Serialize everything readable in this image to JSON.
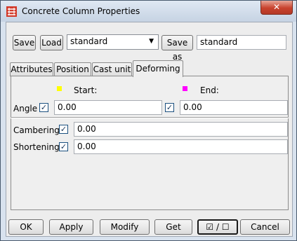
{
  "window": {
    "title": "Concrete Column Properties",
    "close_label": "✕"
  },
  "toolbar": {
    "save_label": "Save",
    "load_label": "Load",
    "preset_value": "standard",
    "save_as_label": "Save as",
    "save_as_value": "standard"
  },
  "tabs": [
    {
      "label": "Attributes"
    },
    {
      "label": "Position"
    },
    {
      "label": "Cast unit"
    },
    {
      "label": "Deforming",
      "active": true
    }
  ],
  "deforming": {
    "start_label": "Start:",
    "end_label": "End:",
    "start_color": "#ffff00",
    "end_color": "#ff00ff",
    "angle": {
      "label": "Angle",
      "start_checked": true,
      "start_value": "0.00",
      "end_checked": true,
      "end_value": "0.00"
    },
    "cambering": {
      "label": "Cambering",
      "checked": true,
      "value": "0.00"
    },
    "shortening": {
      "label": "Shortening",
      "checked": true,
      "value": "0.00"
    }
  },
  "footer": {
    "ok_label": "OK",
    "apply_label": "Apply",
    "modify_label": "Modify",
    "get_label": "Get",
    "toggle_label": "☑ / ☐",
    "cancel_label": "Cancel"
  },
  "colors": {
    "title_bg": "#c6d3e3",
    "close_bg": "#c8422d",
    "check_border": "#1c5180"
  }
}
